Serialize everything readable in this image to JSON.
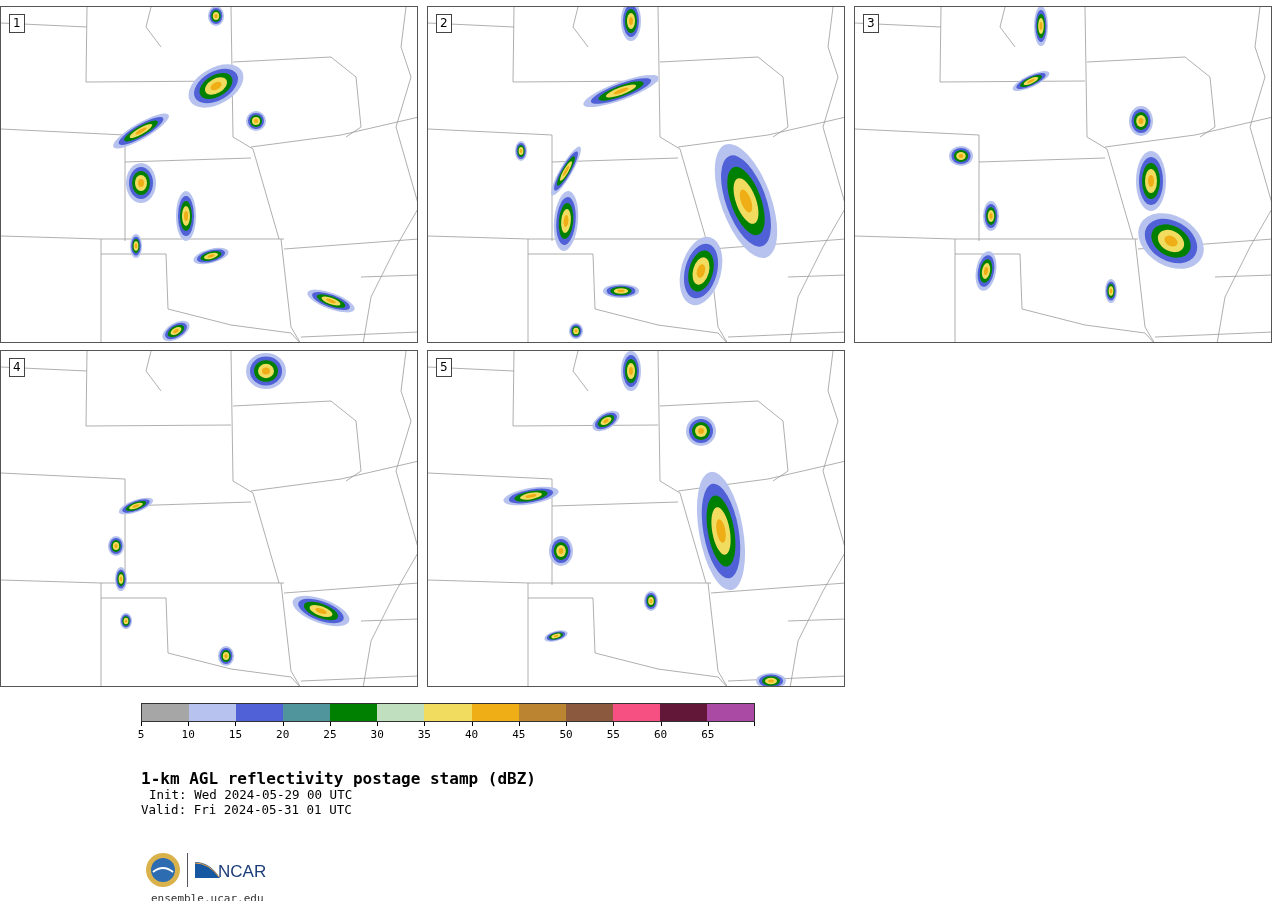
{
  "panels": [
    {
      "label": "1"
    },
    {
      "label": "2"
    },
    {
      "label": "3"
    },
    {
      "label": "4"
    },
    {
      "label": "5"
    }
  ],
  "colorbar": {
    "segments": [
      {
        "color": "#a6a6a6"
      },
      {
        "color": "#b7c3ee"
      },
      {
        "color": "#5060d6"
      },
      {
        "color": "#4f959b"
      },
      {
        "color": "#008000"
      },
      {
        "color": "#bfdfbf"
      },
      {
        "color": "#f1dc5f"
      },
      {
        "color": "#f0ae16"
      },
      {
        "color": "#bb8430"
      },
      {
        "color": "#8b5a3e"
      },
      {
        "color": "#f65082"
      },
      {
        "color": "#621638"
      },
      {
        "color": "#ab4aa4"
      }
    ],
    "ticks": [
      "5",
      "10",
      "15",
      "20",
      "25",
      "30",
      "35",
      "40",
      "45",
      "50",
      "55",
      "60",
      "65"
    ]
  },
  "title": "1-km AGL reflectivity postage stamp (dBZ)",
  "init": "Init: Wed 2024-05-29 00 UTC",
  "valid": "Valid: Fri 2024-05-31 01 UTC",
  "logo_text": "NCAR",
  "site": "ensemble.ucar.edu"
}
